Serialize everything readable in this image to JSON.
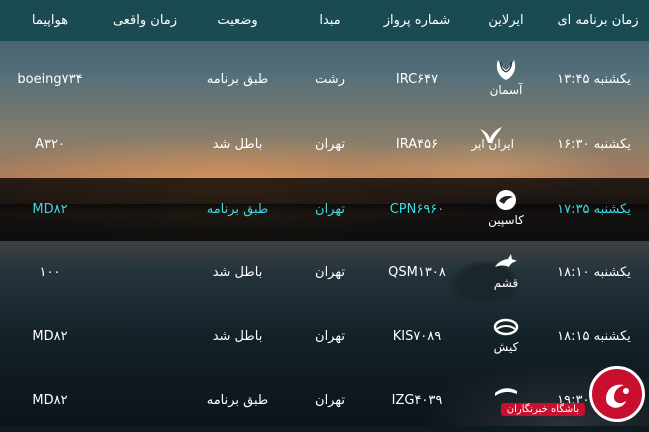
{
  "header": {
    "scheduled_time": "زمان برنامه ای",
    "airline": "ایرلاین",
    "flight_number": "شماره پرواز",
    "origin": "مبدا",
    "status": "وضعیت",
    "actual_time": "زمان واقعی",
    "aircraft": "هواپیما"
  },
  "rows": [
    {
      "time": "یکشنبه ۱۳:۴۵",
      "airline": "آسمان",
      "flight": "IRC۶۴۷",
      "origin": "رشت",
      "status": "طبق برنامه",
      "actual": "",
      "aircraft": "boeing۷۳۴",
      "logo_icon": "wing-bird-icon"
    },
    {
      "time": "یکشنبه ۱۶:۳۰",
      "airline": "ایران ایر",
      "flight": "IRA۴۵۶",
      "origin": "تهران",
      "status": "باطل شد",
      "actual": "",
      "aircraft": "A۳۲۰",
      "logo_icon": "homa-bird-icon"
    },
    {
      "time": "یکشنبه ۱۷:۳۵",
      "airline": "کاسپین",
      "flight": "CPN۶۹۶۰",
      "origin": "تهران",
      "status": "طبق برنامه",
      "actual": "",
      "aircraft": "MD۸۲",
      "logo_icon": "caspian-bird-icon"
    },
    {
      "time": "یکشنبه ۱۸:۱۰",
      "airline": "قشم",
      "flight": "QSM۱۳۰۸",
      "origin": "تهران",
      "status": "باطل شد",
      "actual": "",
      "aircraft": "۱۰۰",
      "logo_icon": "dolphin-icon"
    },
    {
      "time": "یکشنبه ۱۸:۱۵",
      "airline": "کیش",
      "flight": "KIS۷۰۸۹",
      "origin": "تهران",
      "status": "باطل شد",
      "actual": "",
      "aircraft": "MD۸۲",
      "logo_icon": "kish-swoosh-icon"
    },
    {
      "time": "یکشنبه ۱۹:۳۰",
      "airline": "",
      "flight": "IZG۴۰۳۹",
      "origin": "تهران",
      "status": "طبق برنامه",
      "actual": "",
      "aircraft": "MD۸۲",
      "logo_icon": "zagros-wing-icon"
    }
  ],
  "watermark": {
    "text": "باشگاه خبرنگاران"
  },
  "colors": {
    "header_bg": "#1a4a52",
    "highlight_text": "#3fd8e0",
    "highlight_row_bg": "#000000"
  }
}
